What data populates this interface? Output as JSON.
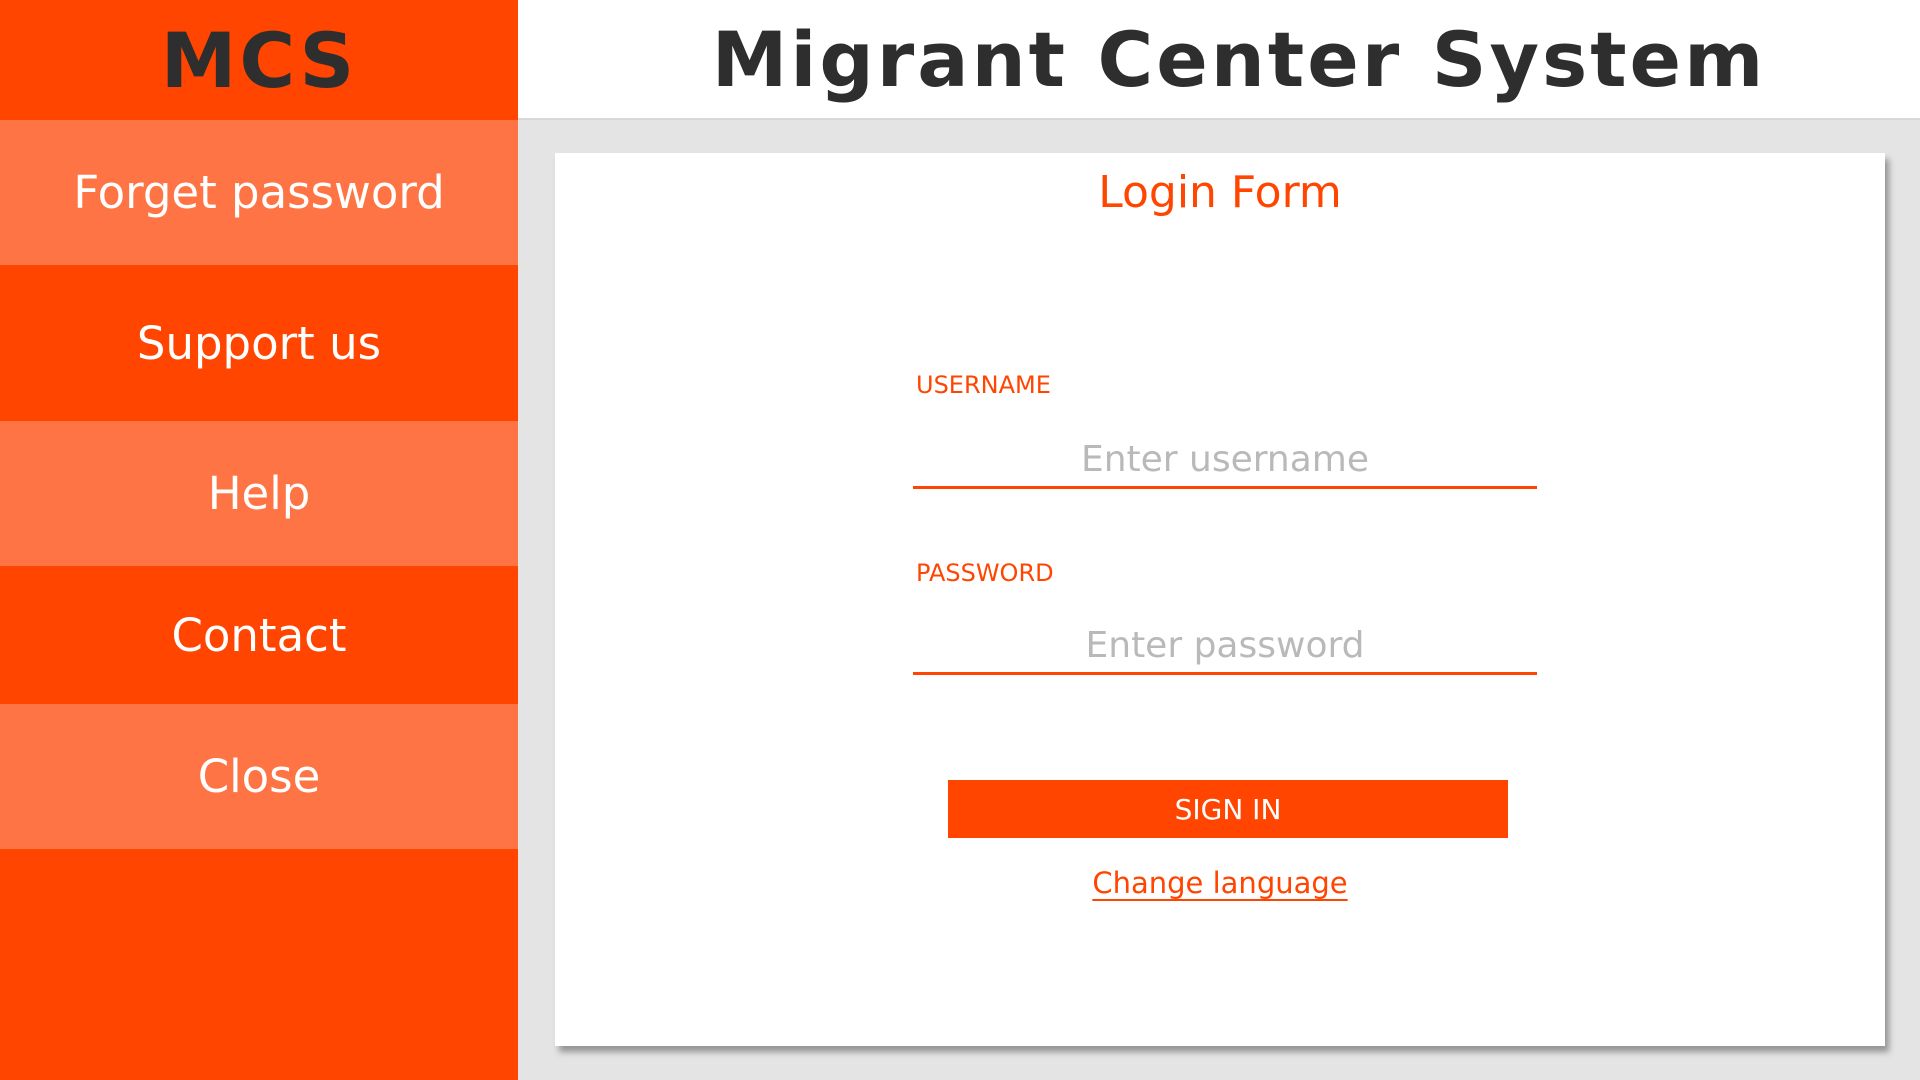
{
  "brand": {
    "short_name": "MCS"
  },
  "header": {
    "title": "Migrant Center System"
  },
  "sidebar": {
    "items": [
      {
        "label": "Forget password"
      },
      {
        "label": "Support us"
      },
      {
        "label": "Help"
      },
      {
        "label": "Contact"
      },
      {
        "label": "Close"
      }
    ]
  },
  "login": {
    "title": "Login Form",
    "username_label": "USERNAME",
    "username_placeholder": "Enter username",
    "password_label": "PASSWORD",
    "password_placeholder": "Enter password",
    "signin_label": "SIGN IN",
    "change_language_label": "Change language"
  },
  "colors": {
    "accent": "#ff4500",
    "accent_light": "#ff7444",
    "title_text": "#2e2e2e",
    "background": "#e4e4e4"
  }
}
